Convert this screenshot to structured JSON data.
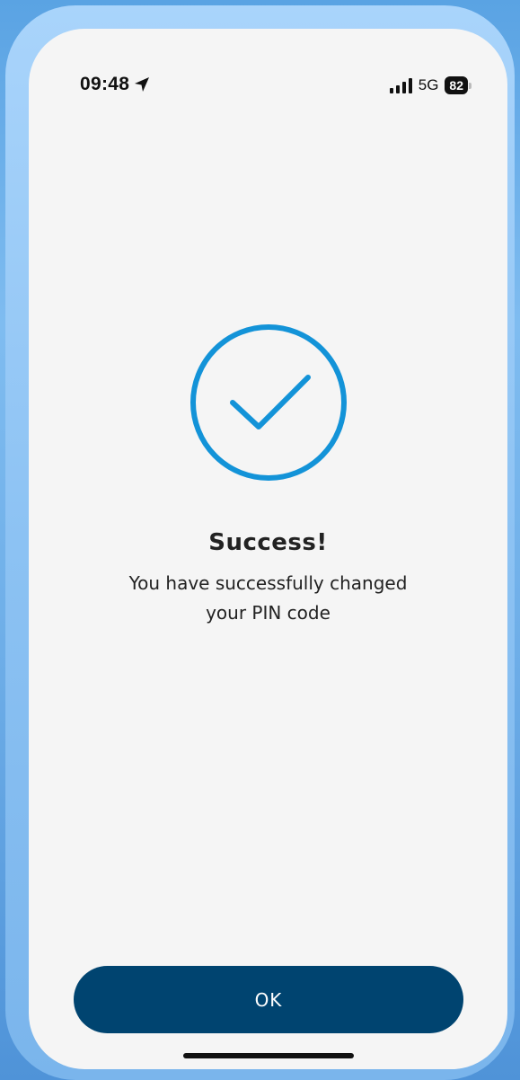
{
  "status_bar": {
    "time": "09:48",
    "location_icon": "location-arrow-icon",
    "signal_icon": "cellular-signal-icon",
    "network": "5G",
    "battery_level": "82",
    "battery_icon": "battery-icon"
  },
  "main": {
    "icon": "checkmark-circle-icon",
    "title": "Success!",
    "message": "You have successfully changed your PIN code"
  },
  "actions": {
    "ok_label": "OK"
  },
  "colors": {
    "accent": "#1393D8",
    "button_bg": "#004470",
    "screen_bg": "#F5F5F5",
    "text": "#222222"
  }
}
